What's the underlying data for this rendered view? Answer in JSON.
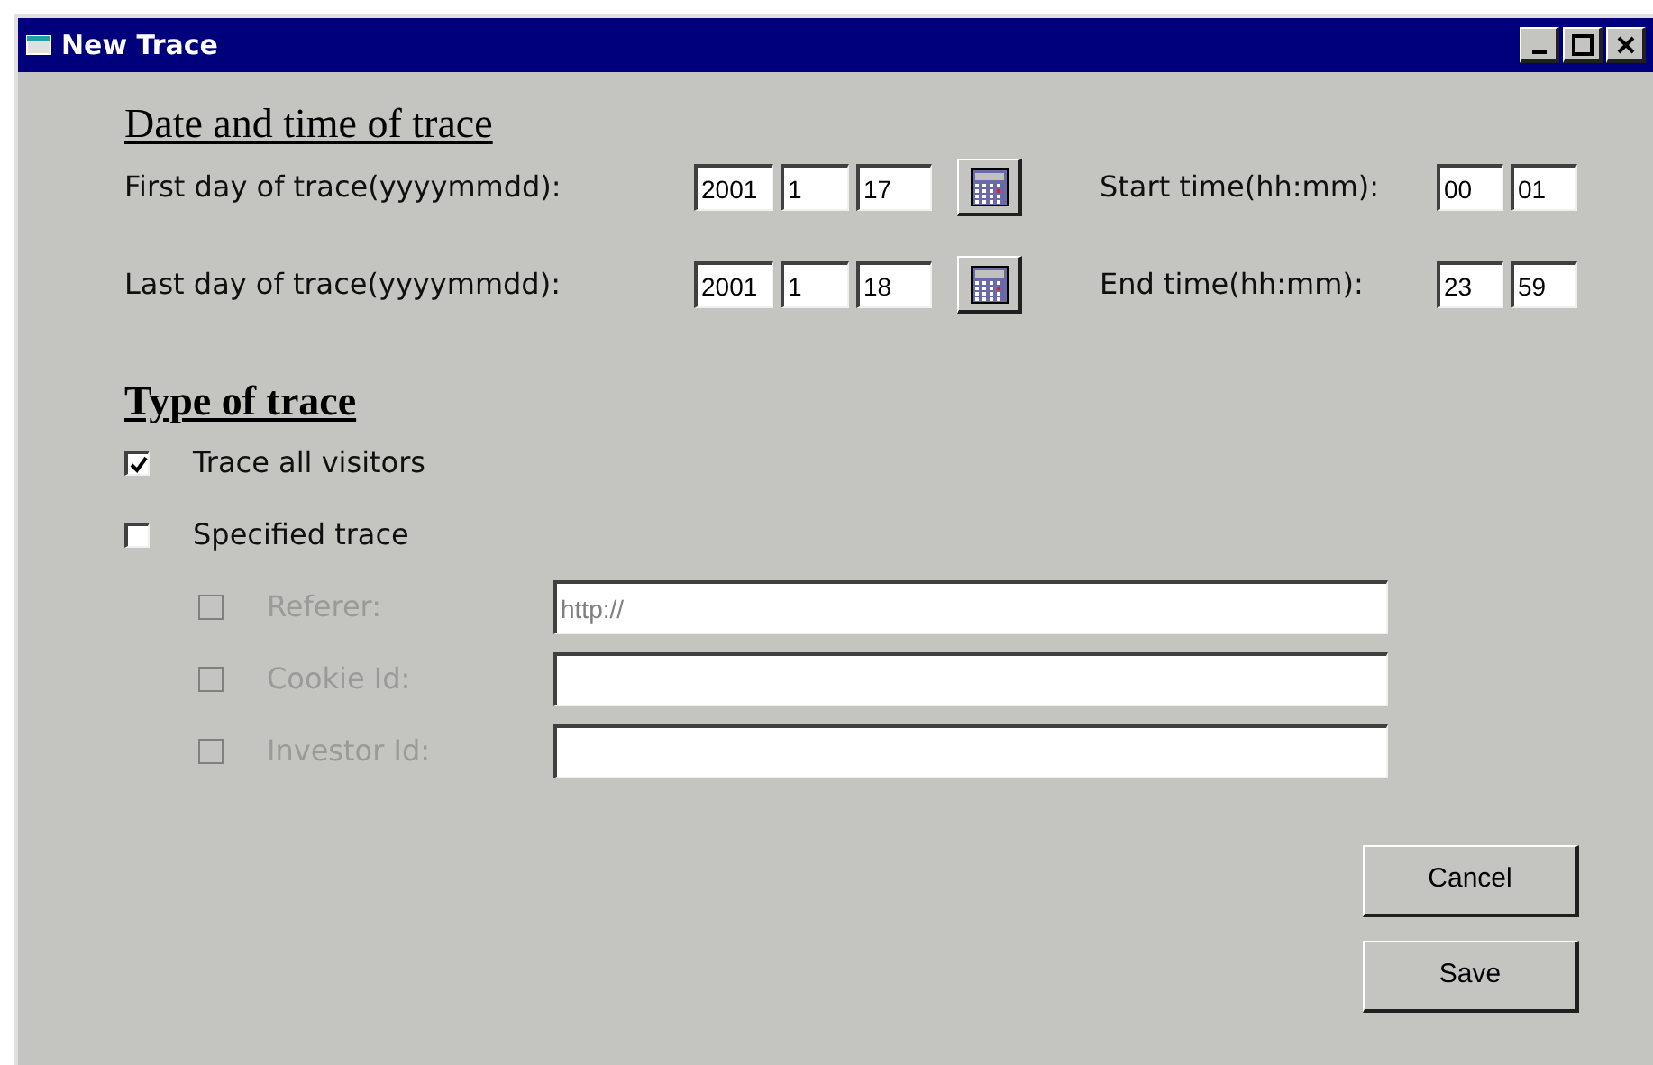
{
  "window": {
    "title": "New Trace"
  },
  "date_section": {
    "heading": "Date and time of trace",
    "rows": [
      {
        "label": "First day of trace(yyyymmdd):",
        "date": [
          "2001",
          "1",
          "17"
        ],
        "time_label": "Start time(hh:mm):",
        "time": [
          "00",
          "01"
        ]
      },
      {
        "label": "Last day of trace(yyyymmdd):",
        "date": [
          "2001",
          "1",
          "18"
        ],
        "time_label": "End time(hh:mm):",
        "time": [
          "23",
          "59"
        ]
      }
    ]
  },
  "type_section": {
    "heading": "Type of trace",
    "options": [
      {
        "label": "Trace all visitors",
        "checked": true
      },
      {
        "label": "Specified trace",
        "checked": false
      }
    ],
    "specified": [
      {
        "label": "Referer:",
        "checked": false,
        "disabled": true,
        "placeholder": "http://"
      },
      {
        "label": "Cookie Id:",
        "checked": false,
        "disabled": true
      },
      {
        "label": "Investor Id:",
        "checked": false,
        "disabled": true
      }
    ]
  },
  "buttons": [
    "Cancel",
    "Save"
  ]
}
